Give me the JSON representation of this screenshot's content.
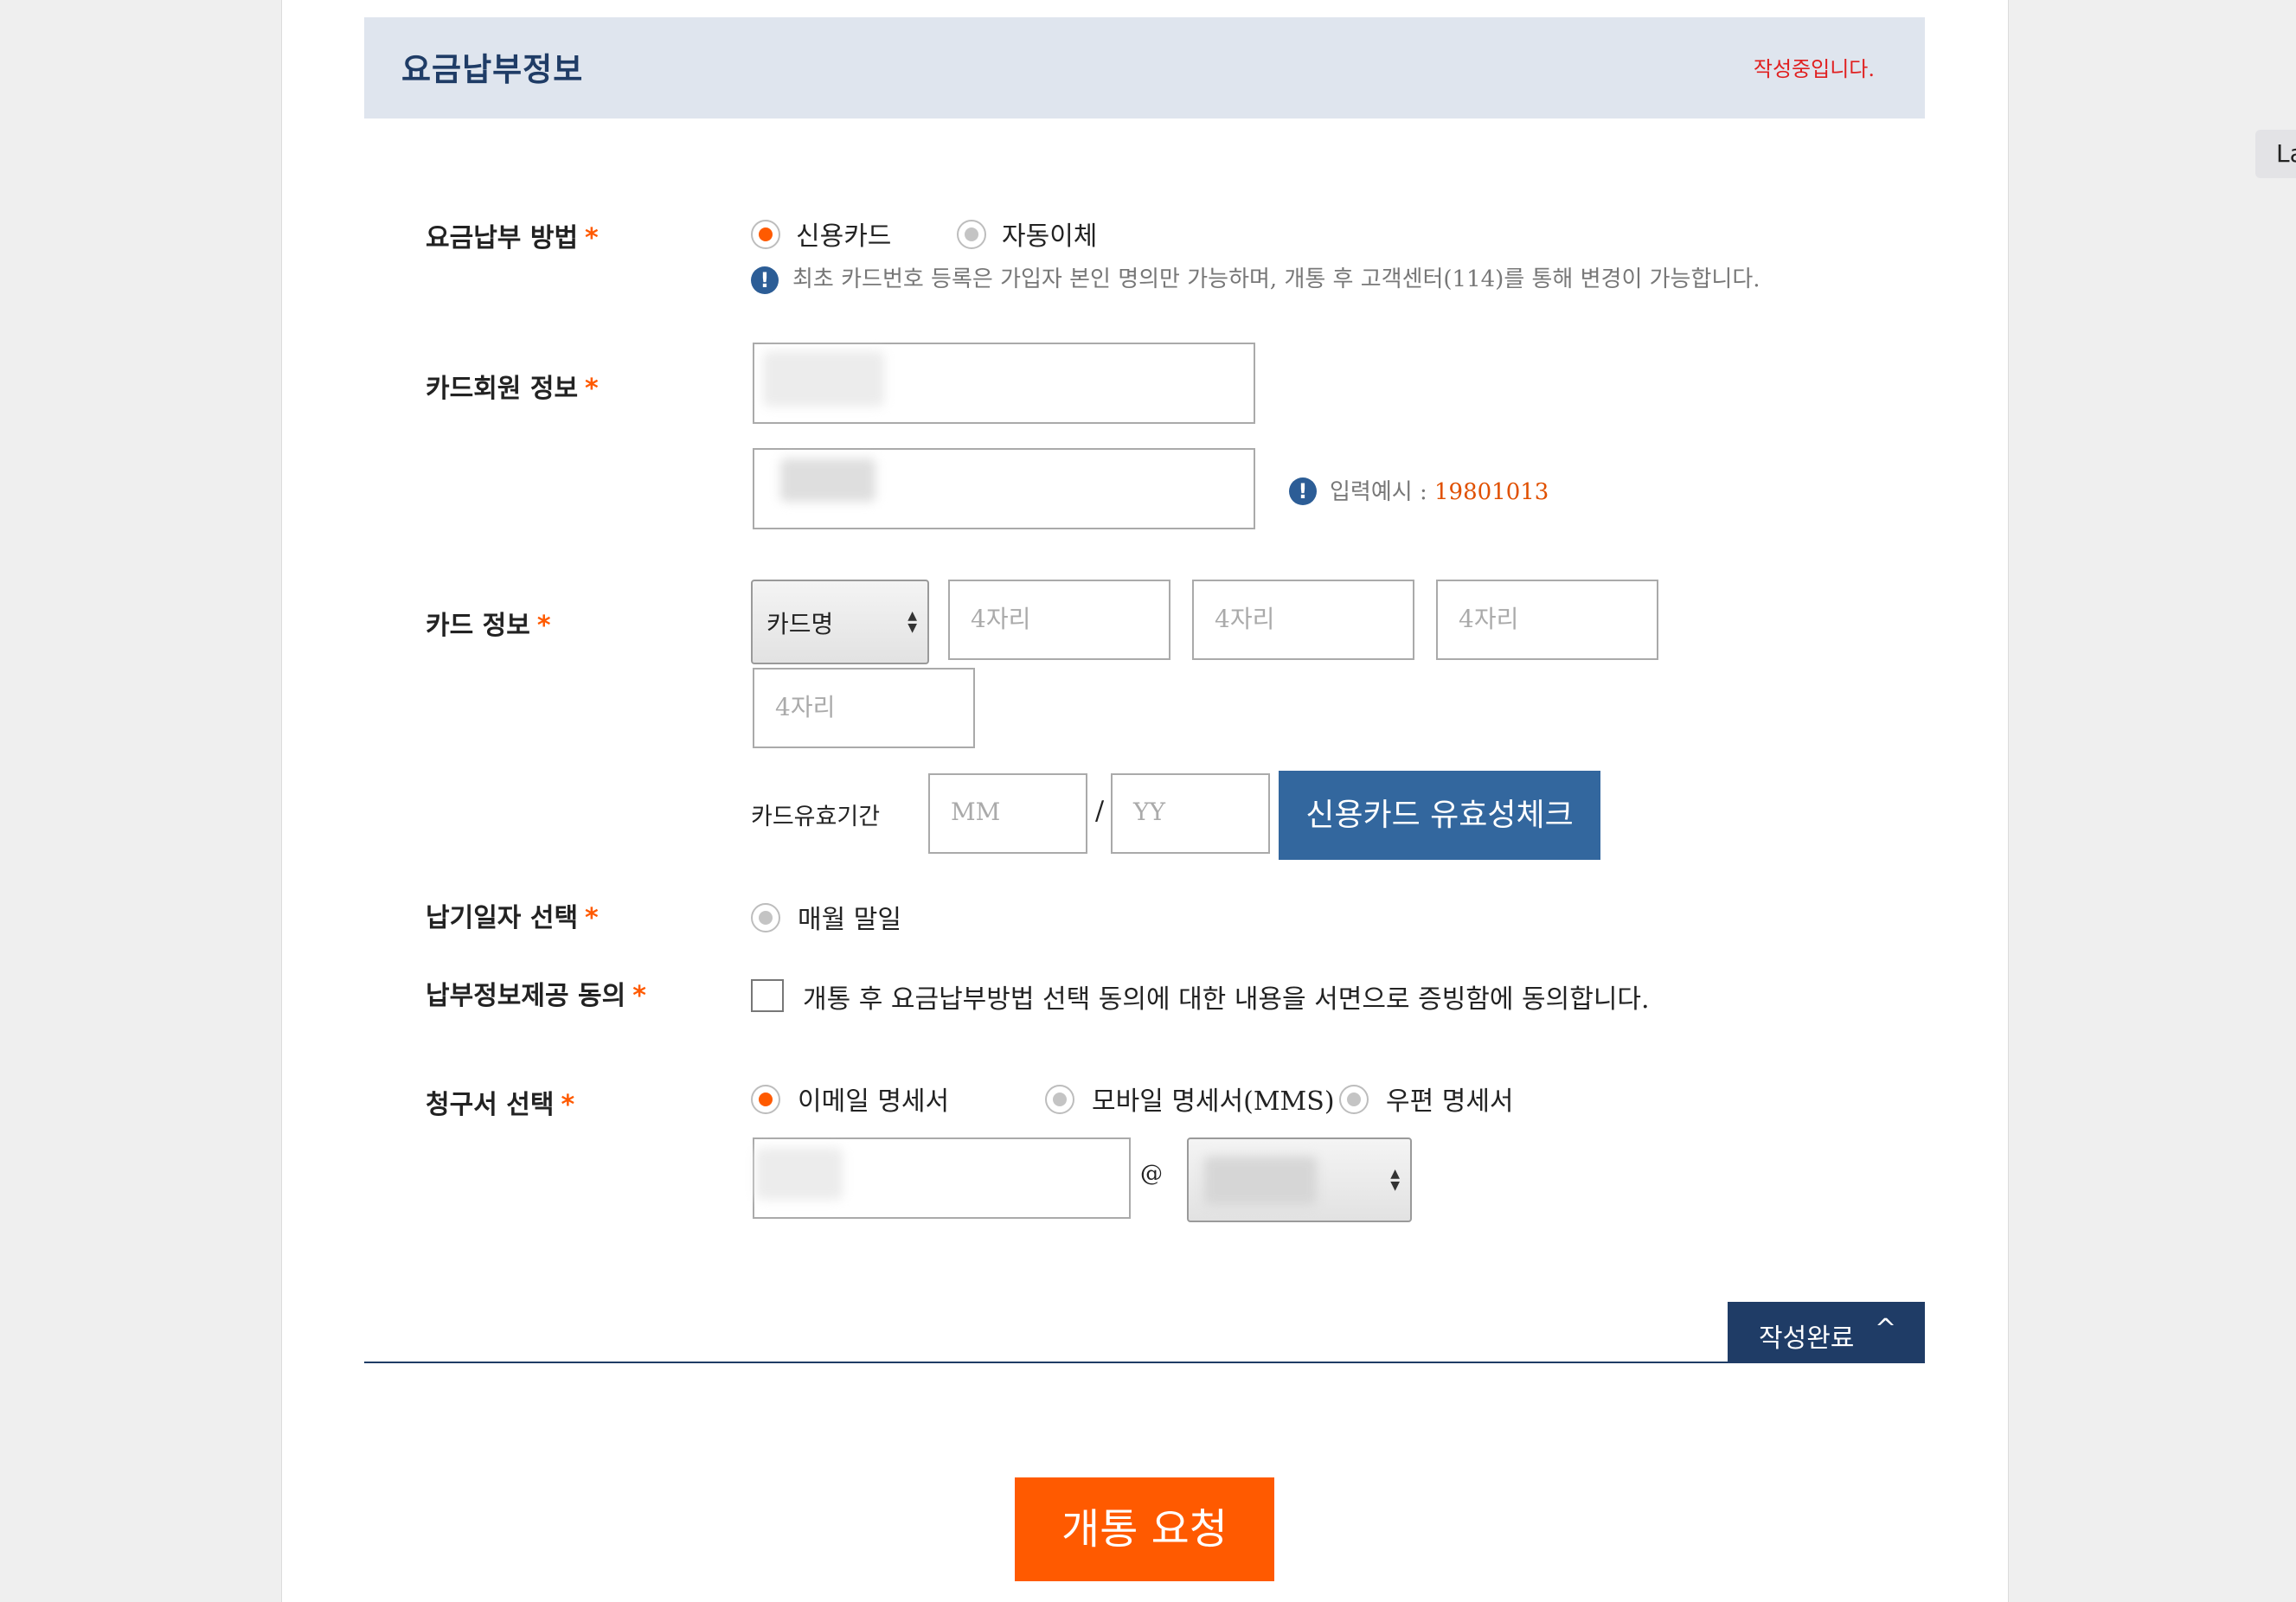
{
  "section": {
    "title": "요금납부정보",
    "status": "작성중입니다."
  },
  "payment_method": {
    "label": "요금납부 방법",
    "options": [
      "신용카드",
      "자동이체"
    ],
    "selected": "신용카드",
    "notice": "최초 카드번호 등록은 가입자 본인 명의만 가능하며, 개통 후 고객센터(114)를 통해 변경이 가능합니다."
  },
  "card_member": {
    "label": "카드회원 정보",
    "birth_hint_prefix": "입력예시 : ",
    "birth_hint_value": "19801013"
  },
  "card_info": {
    "label": "카드 정보",
    "card_select": "카드명",
    "digit_placeholder": "4자리",
    "expiry_label": "카드유효기간",
    "mm_placeholder": "MM",
    "slash": "/",
    "yy_placeholder": "YY",
    "check_button": "신용카드 유효성체크"
  },
  "due_date": {
    "label": "납기일자 선택",
    "option": "매월 말일"
  },
  "consent": {
    "label": "납부정보제공 동의",
    "text": "개통 후 요금납부방법 선택 동의에 대한 내용을 서면으로 증빙함에 동의합니다.",
    "checked": false
  },
  "bill": {
    "label": "청구서 선택",
    "options": [
      "이메일 명세서",
      "모바일 명세서(MMS)",
      "우편 명세서"
    ],
    "selected": "이메일 명세서",
    "at": "@"
  },
  "required_mark": "*",
  "done_button": "작성완료",
  "submit_button": "개통 요청",
  "side_tab": "La",
  "colors": {
    "accent": "#ff5a00",
    "navy": "#1f3c66",
    "blue_button": "#33679e",
    "header_bg": "#dfe5ee"
  }
}
